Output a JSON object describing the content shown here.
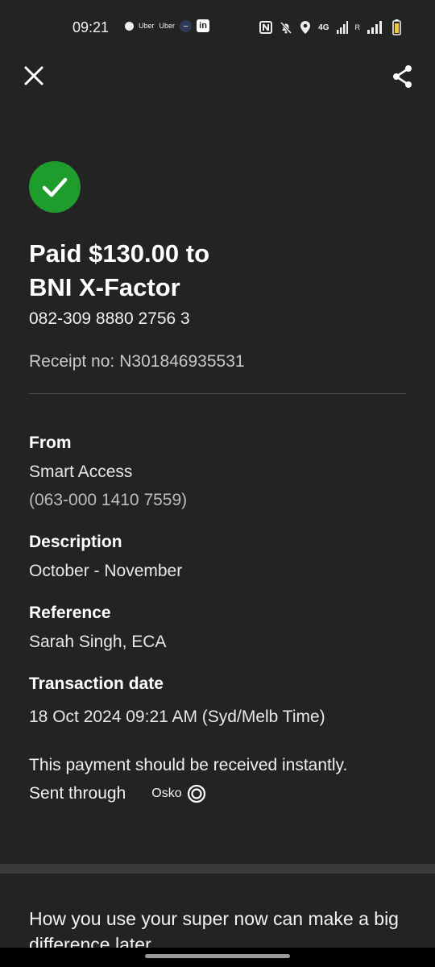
{
  "status_bar": {
    "time": "09:21",
    "notification_apps": [
      "Uber",
      "Uber"
    ],
    "linkedin_label": "in",
    "network_label": "4G",
    "signal_label": "R"
  },
  "header": {
    "close_icon": "close-icon",
    "share_icon": "share-icon"
  },
  "payment": {
    "title_line1": "Paid $130.00 to",
    "title_line2": "BNI X-Factor",
    "account_number": "082-309 8880 2756 3",
    "receipt_label": "Receipt no:",
    "receipt_number": "N301846935531"
  },
  "details": {
    "from_label": "From",
    "from_account_name": "Smart Access",
    "from_account_number": "(063-000 1410 7559)",
    "description_label": "Description",
    "description_value": "October - November",
    "reference_label": "Reference",
    "reference_value": "Sarah Singh, ECA",
    "transaction_date_label": "Transaction date",
    "transaction_date_value": "18 Oct 2024 09:21 AM (Syd/Melb Time)"
  },
  "notice": {
    "text": "This payment should be received instantly.",
    "sent_through_label": "Sent through",
    "network_name": "Osko"
  },
  "promo": {
    "text": "How you use your super now can make a big difference later."
  },
  "colors": {
    "background": "#232323",
    "success_green": "#1f9d2c",
    "divider": "#4a4a4a"
  }
}
